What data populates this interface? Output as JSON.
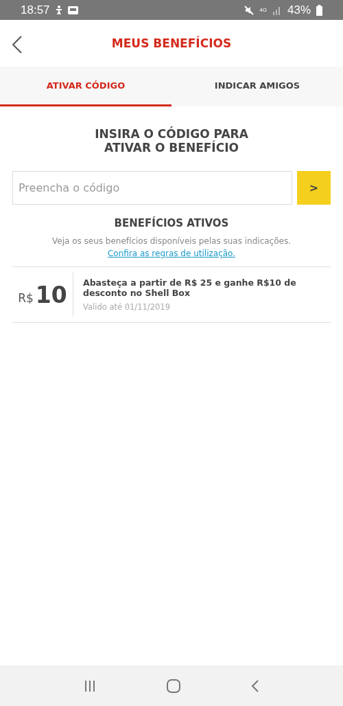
{
  "status_bar": {
    "time": "18:57",
    "battery": "43%",
    "network": "4G"
  },
  "header": {
    "title": "MEUS BENEFÍCIOS"
  },
  "tabs": [
    {
      "label": "ATIVAR CÓDIGO",
      "selected": true
    },
    {
      "label": "INDICAR AMIGOS",
      "selected": false
    }
  ],
  "code_section": {
    "heading": "INSIRA O CÓDIGO PARA ATIVAR O BENEFÍCIO",
    "placeholder": "Preencha o código",
    "submit": ">"
  },
  "active_benefits": {
    "title": "BENEFÍCIOS ATIVOS",
    "description": "Veja os seus benefícios disponíveis pelas suas indicações.",
    "link": "Confira as regras de utilização.",
    "items": [
      {
        "currency": "R$",
        "amount": "10",
        "description": "Abasteça a partir de R$ 25 e ganhe R$10 de desconto no Shell Box",
        "validity": "Valido até 01/11/2019"
      }
    ]
  }
}
